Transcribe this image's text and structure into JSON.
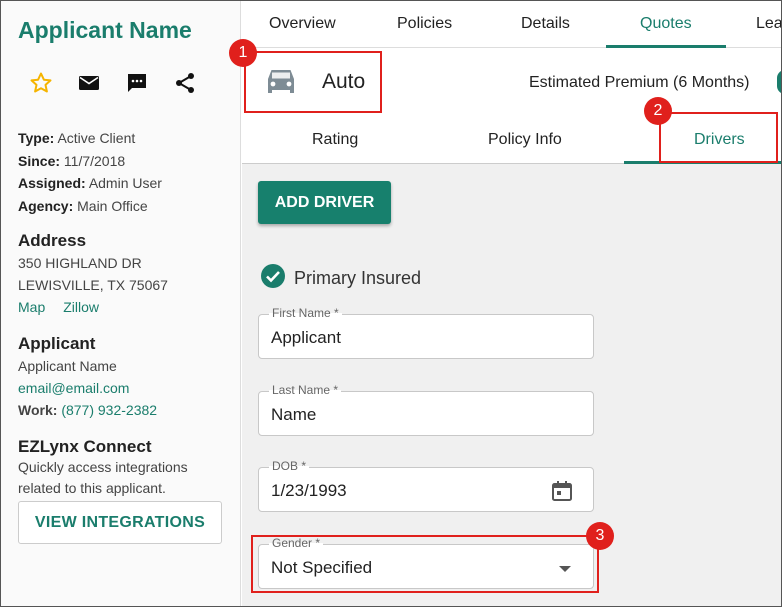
{
  "sidebar": {
    "applicant_name": "Applicant Name",
    "icons": [
      "star-icon",
      "mail-icon",
      "chat-icon",
      "share-icon"
    ],
    "info": {
      "type_label": "Type:",
      "type_value": "Active Client",
      "since_label": "Since:",
      "since_value": "11/7/2018",
      "assigned_label": "Assigned:",
      "assigned_value": "Admin User",
      "agency_label": "Agency:",
      "agency_value": "Main Office"
    },
    "address": {
      "heading": "Address",
      "line1": "350 HIGHLAND DR",
      "line2": "LEWISVILLE, TX 75067",
      "map_link": "Map",
      "zillow_link": "Zillow"
    },
    "applicant": {
      "heading": "Applicant",
      "name": "Applicant Name",
      "email": "email@email.com",
      "work_label": "Work:",
      "work_value": "(877) 932-2382"
    },
    "ezlynx": {
      "heading": "EZLynx Connect",
      "desc1": "Quickly access integrations",
      "desc2": "related to this applicant.",
      "button": "VIEW INTEGRATIONS"
    }
  },
  "topnav": {
    "tabs": [
      "Overview",
      "Policies",
      "Details",
      "Quotes",
      "Lea"
    ],
    "active": "Quotes"
  },
  "quote": {
    "line_of_business": "Auto",
    "premium_label": "Estimated Premium (6 Months)"
  },
  "subtabs": {
    "items": [
      "Rating",
      "Policy Info",
      "Drivers"
    ],
    "active": "Drivers"
  },
  "drivers": {
    "add_button": "ADD DRIVER",
    "primary_insured": "Primary Insured",
    "first_name": {
      "label": "First Name *",
      "value": "Applicant"
    },
    "last_name": {
      "label": "Last Name *",
      "value": "Name"
    },
    "dob": {
      "label": "DOB *",
      "value": "1/23/1993"
    },
    "gender": {
      "label": "Gender *",
      "value": "Not Specified"
    }
  },
  "annotations": [
    "1",
    "2",
    "3"
  ],
  "colors": {
    "accent": "#1a7d6c",
    "annotation": "#e0201c",
    "star": "#f5b400"
  }
}
